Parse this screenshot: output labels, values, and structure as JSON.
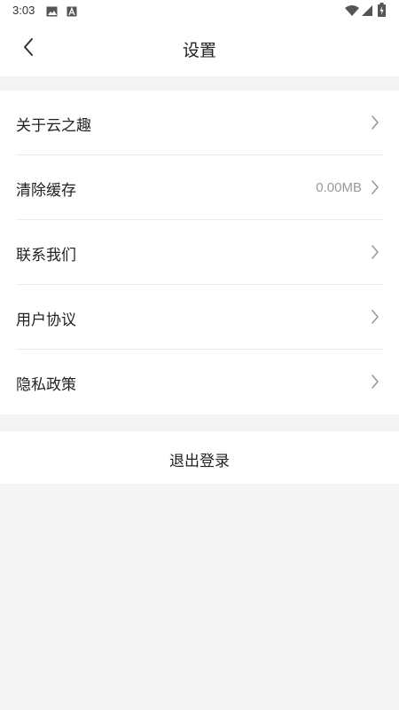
{
  "status_bar": {
    "time": "3:03",
    "left_icons": [
      "image-icon",
      "text-a-icon"
    ],
    "right_icons": [
      "wifi-icon",
      "signal-icon",
      "battery-charging-icon"
    ]
  },
  "header": {
    "back_icon": "chevron-left-icon",
    "title": "设置"
  },
  "menu": {
    "items": [
      {
        "label": "关于云之趣",
        "value": "",
        "icon": "chevron-right-icon"
      },
      {
        "label": "清除缓存",
        "value": "0.00MB",
        "icon": "chevron-right-icon"
      },
      {
        "label": "联系我们",
        "value": "",
        "icon": "chevron-right-icon"
      },
      {
        "label": "用户协议",
        "value": "",
        "icon": "chevron-right-icon"
      },
      {
        "label": "隐私政策",
        "value": "",
        "icon": "chevron-right-icon"
      }
    ]
  },
  "logout": {
    "label": "退出登录"
  },
  "colors": {
    "background": "#f4f4f4",
    "surface": "#ffffff",
    "text": "#222222",
    "secondary_text": "#999999",
    "divider": "#ececec"
  }
}
